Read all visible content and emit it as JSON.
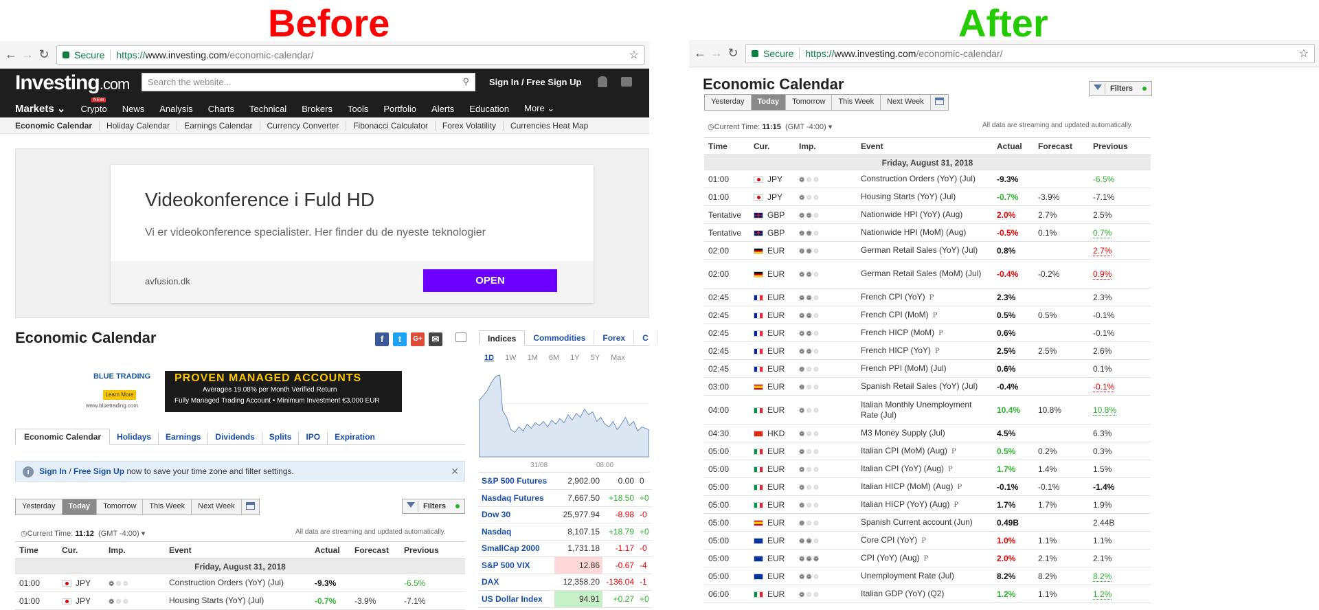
{
  "headings": {
    "before": "Before",
    "after": "After",
    "before_color": "#ff0000",
    "after_color": "#22cc00"
  },
  "browser": {
    "secure_label": "Secure",
    "url_scheme": "https://",
    "url_host": "www.investing.com",
    "url_path": "/economic-calendar/"
  },
  "site": {
    "logo_main": "Investing",
    "logo_suffix": ".com",
    "search_placeholder": "Search the website...",
    "signin": "Sign In",
    "signin_sep": "/",
    "signup": "Free Sign Up",
    "nav": [
      "Markets",
      "Crypto",
      "News",
      "Analysis",
      "Charts",
      "Technical",
      "Brokers",
      "Tools",
      "Portfolio",
      "Alerts",
      "Education",
      "More"
    ],
    "nav_new_badge": "NEW",
    "subnav": [
      "Economic Calendar",
      "Holiday Calendar",
      "Earnings Calendar",
      "Currency Converter",
      "Fibonacci Calculator",
      "Forex Volatility",
      "Currencies Heat Map"
    ]
  },
  "ad": {
    "title": "Videokonference i Fuld HD",
    "subtitle": "Vi er videokonference specialister. Her finder du de nyeste teknologier",
    "domain": "avfusion.dk",
    "button": "OPEN"
  },
  "bt_ad": {
    "brand": "BLUE TRADING",
    "learn": "Learn More",
    "url": "www.bluetrading.com",
    "headline": "PROVEN MANAGED ACCOUNTS",
    "line1": "Averages 19.08% per Month Verified Return",
    "line2": "Fully Managed Trading Account  •  Minimum Investment €3,000 EUR"
  },
  "calendar": {
    "title": "Economic Calendar",
    "section_tabs": [
      "Economic Calendar",
      "Holidays",
      "Earnings",
      "Dividends",
      "Splits",
      "IPO",
      "Expiration"
    ],
    "signin_bar": {
      "signin": "Sign In",
      "sep": "/",
      "signup": "Free Sign Up",
      "rest": " now to save your time zone and filter settings."
    },
    "day_buttons": [
      "Yesterday",
      "Today",
      "Tomorrow",
      "This Week",
      "Next Week"
    ],
    "filters": "Filters",
    "current_time_label": "Current Time:",
    "current_time_before": "11:12",
    "current_time_after": "11:15",
    "timezone": "(GMT -4:00)",
    "streaming": "All data are streaming and updated automatically.",
    "columns": [
      "Time",
      "Cur.",
      "Imp.",
      "Event",
      "Actual",
      "Forecast",
      "Previous"
    ],
    "day_label": "Friday, August 31, 2018",
    "rows": [
      {
        "time": "01:00",
        "cur": "JPY",
        "flag": "jpy",
        "imp": 1,
        "event": "Construction Orders (YoY) (Jul)",
        "actual": "-9.3%",
        "actual_cls": "blk",
        "forecast": "",
        "previous": "-6.5%",
        "prev_cls": "green-plain"
      },
      {
        "time": "01:00",
        "cur": "JPY",
        "flag": "jpy",
        "imp": 1,
        "event": "Housing Starts (YoY) (Jul)",
        "actual": "-0.7%",
        "actual_cls": "green",
        "forecast": "-3.9%",
        "previous": "-7.1%",
        "prev_cls": ""
      },
      {
        "time": "Tentative",
        "cur": "GBP",
        "flag": "gbp",
        "imp": 2,
        "event": "Nationwide HPI (YoY) (Aug)",
        "actual": "2.0%",
        "actual_cls": "red",
        "forecast": "2.7%",
        "previous": "2.5%",
        "prev_cls": ""
      },
      {
        "time": "Tentative",
        "cur": "GBP",
        "flag": "gbp",
        "imp": 2,
        "event": "Nationwide HPI (MoM) (Aug)",
        "actual": "-0.5%",
        "actual_cls": "red",
        "forecast": "0.1%",
        "previous": "0.7%",
        "prev_cls": "prev-green"
      },
      {
        "time": "02:00",
        "cur": "EUR",
        "flag": "eur-de",
        "imp": 2,
        "event": "German Retail Sales (YoY) (Jul)",
        "actual": "0.8%",
        "actual_cls": "blk",
        "forecast": "",
        "previous": "2.7%",
        "prev_cls": "prev-red"
      },
      {
        "time": "02:00",
        "cur": "EUR",
        "flag": "eur-de",
        "imp": 2,
        "event": "German Retail Sales (MoM) (Jul)",
        "actual": "-0.4%",
        "actual_cls": "red",
        "forecast": "-0.2%",
        "previous": "0.9%",
        "prev_cls": "prev-red",
        "tall": true
      },
      {
        "time": "02:45",
        "cur": "EUR",
        "flag": "eur-fr",
        "imp": 2,
        "event": "French CPI (YoY)",
        "p": true,
        "actual": "2.3%",
        "actual_cls": "blk",
        "forecast": "",
        "previous": "2.3%",
        "prev_cls": ""
      },
      {
        "time": "02:45",
        "cur": "EUR",
        "flag": "eur-fr",
        "imp": 2,
        "event": "French CPI (MoM)",
        "p": true,
        "actual": "0.5%",
        "actual_cls": "blk",
        "forecast": "0.5%",
        "previous": "-0.1%",
        "prev_cls": ""
      },
      {
        "time": "02:45",
        "cur": "EUR",
        "flag": "eur-fr",
        "imp": 2,
        "event": "French HICP (MoM)",
        "p": true,
        "actual": "0.6%",
        "actual_cls": "blk",
        "forecast": "",
        "previous": "-0.1%",
        "prev_cls": ""
      },
      {
        "time": "02:45",
        "cur": "EUR",
        "flag": "eur-fr",
        "imp": 2,
        "event": "French HICP (YoY)",
        "p": true,
        "actual": "2.5%",
        "actual_cls": "blk",
        "forecast": "2.5%",
        "previous": "2.6%",
        "prev_cls": ""
      },
      {
        "time": "02:45",
        "cur": "EUR",
        "flag": "eur-fr",
        "imp": 1,
        "event": "French PPI (MoM) (Jul)",
        "actual": "0.6%",
        "actual_cls": "blk",
        "forecast": "",
        "previous": "0.1%",
        "prev_cls": ""
      },
      {
        "time": "03:00",
        "cur": "EUR",
        "flag": "eur-es",
        "imp": 1,
        "event": "Spanish Retail Sales (YoY) (Jul)",
        "actual": "-0.4%",
        "actual_cls": "blk",
        "forecast": "",
        "previous": "-0.1%",
        "prev_cls": "prev-red"
      },
      {
        "time": "04:00",
        "cur": "EUR",
        "flag": "eur-it",
        "imp": 1,
        "event": "Italian Monthly Unemployment Rate (Jul)",
        "actual": "10.4%",
        "actual_cls": "green",
        "forecast": "10.8%",
        "previous": "10.8%",
        "prev_cls": "prev-green",
        "tall": true
      },
      {
        "time": "04:30",
        "cur": "HKD",
        "flag": "hkd",
        "imp": 1,
        "event": "M3 Money Supply (Jul)",
        "actual": "4.5%",
        "actual_cls": "blk",
        "forecast": "",
        "previous": "6.3%",
        "prev_cls": ""
      },
      {
        "time": "05:00",
        "cur": "EUR",
        "flag": "eur-it",
        "imp": 1,
        "event": "Italian CPI (MoM) (Aug)",
        "p": true,
        "actual": "0.5%",
        "actual_cls": "green",
        "forecast": "0.2%",
        "previous": "0.3%",
        "prev_cls": ""
      },
      {
        "time": "05:00",
        "cur": "EUR",
        "flag": "eur-it",
        "imp": 1,
        "event": "Italian CPI (YoY) (Aug)",
        "p": true,
        "actual": "1.7%",
        "actual_cls": "green",
        "forecast": "1.4%",
        "previous": "1.5%",
        "prev_cls": ""
      },
      {
        "time": "05:00",
        "cur": "EUR",
        "flag": "eur-it",
        "imp": 1,
        "event": "Italian HICP (MoM) (Aug)",
        "p": true,
        "actual": "-0.1%",
        "actual_cls": "blk",
        "forecast": "-0.1%",
        "previous": "-1.4%",
        "prev_cls": "blk"
      },
      {
        "time": "05:00",
        "cur": "EUR",
        "flag": "eur-it",
        "imp": 1,
        "event": "Italian HICP (YoY) (Aug)",
        "p": true,
        "actual": "1.7%",
        "actual_cls": "blk",
        "forecast": "1.7%",
        "previous": "1.9%",
        "prev_cls": ""
      },
      {
        "time": "05:00",
        "cur": "EUR",
        "flag": "eur-es",
        "imp": 1,
        "event": "Spanish Current account (Jun)",
        "actual": "0.49B",
        "actual_cls": "blk",
        "forecast": "",
        "previous": "2.44B",
        "prev_cls": ""
      },
      {
        "time": "05:00",
        "cur": "EUR",
        "flag": "eur-eu",
        "imp": 2,
        "event": "Core CPI (YoY)",
        "p": true,
        "actual": "1.0%",
        "actual_cls": "red",
        "forecast": "1.1%",
        "previous": "1.1%",
        "prev_cls": ""
      },
      {
        "time": "05:00",
        "cur": "EUR",
        "flag": "eur-eu",
        "imp": 3,
        "event": "CPI (YoY) (Aug)",
        "p": true,
        "actual": "2.0%",
        "actual_cls": "red",
        "forecast": "2.1%",
        "previous": "2.1%",
        "prev_cls": ""
      },
      {
        "time": "05:00",
        "cur": "EUR",
        "flag": "eur-eu",
        "imp": 2,
        "event": "Unemployment Rate (Jul)",
        "actual": "8.2%",
        "actual_cls": "blk",
        "forecast": "8.2%",
        "previous": "8.2%",
        "prev_cls": "prev-green"
      },
      {
        "time": "06:00",
        "cur": "EUR",
        "flag": "eur-it",
        "imp": 1,
        "event": "Italian GDP (YoY) (Q2)",
        "actual": "1.2%",
        "actual_cls": "green",
        "forecast": "1.1%",
        "previous": "1.2%",
        "prev_cls": "prev-green"
      }
    ]
  },
  "markets": {
    "tabs": [
      "Indices",
      "Commodities",
      "Forex",
      "C"
    ],
    "periods": [
      "1D",
      "1W",
      "1M",
      "6M",
      "1Y",
      "5Y",
      "Max"
    ],
    "axis_labels": [
      "31/08",
      "08:00"
    ],
    "quotes": [
      {
        "name": "S&P 500 Futures",
        "value": "2,902.00",
        "change": "0.00",
        "pct": "0"
      },
      {
        "name": "Nasdaq Futures",
        "value": "7,667.50",
        "change": "+18.50",
        "pct": "+0"
      },
      {
        "name": "Dow 30",
        "value": "25,977.94",
        "change": "-8.98",
        "pct": "-0"
      },
      {
        "name": "Nasdaq",
        "value": "8,107.15",
        "change": "+18.79",
        "pct": "+0"
      },
      {
        "name": "SmallCap 2000",
        "value": "1,731.18",
        "change": "-1.17",
        "pct": "-0"
      },
      {
        "name": "S&P 500 VIX",
        "value": "12.86",
        "change": "-0.67",
        "pct": "-4"
      },
      {
        "name": "DAX",
        "value": "12,358.20",
        "change": "-136.04",
        "pct": "-1"
      },
      {
        "name": "US Dollar Index",
        "value": "94.91",
        "change": "+0.27",
        "pct": "+0"
      }
    ]
  }
}
